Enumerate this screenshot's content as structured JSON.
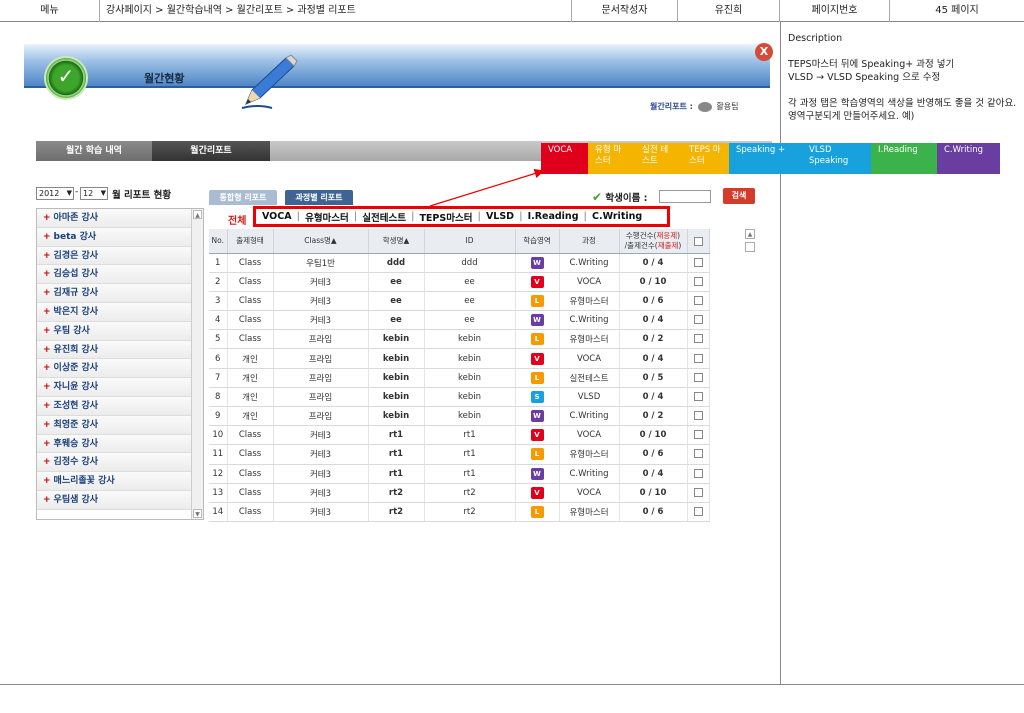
{
  "doc_header": {
    "menu_label": "메뉴",
    "path": "강사페이지 > 월간학습내역 > 월간리포트 > 과정별 리포트",
    "author_label": "문서작성자",
    "author": "유진희",
    "page_label": "페이지번호",
    "page": "45 페이지"
  },
  "description": {
    "title": "Description",
    "line1": "TEPS마스터 뒤에 Speaking+ 과정 넣기",
    "line2": "VLSD → VLSD Speaking 으로 수정",
    "line3": "각 과정 탭은 학습영역의 색상을 반영해도 좋을 것 같아요. 영역구분되게 만들어주세요. 예)"
  },
  "banner": {
    "title": "월간현황",
    "close": "X",
    "tip_label": "월간리포트 :",
    "tip_text": "활용팁"
  },
  "nav_tabs": [
    "월간 학습 내역",
    "월간리포트"
  ],
  "area_tabs": [
    {
      "label": "VOCA",
      "color": "#e0001b"
    },
    {
      "label": "유형 마스터",
      "color": "#f5b400"
    },
    {
      "label": "실전 테스트",
      "color": "#f5b400"
    },
    {
      "label": "TEPS 마스터",
      "color": "#f5b400"
    },
    {
      "label": "Speaking +",
      "color": "#17a2dd"
    },
    {
      "label": "VLSD Speaking",
      "color": "#17a2dd"
    },
    {
      "label": "I.Reading",
      "color": "#3bb34a"
    },
    {
      "label": "C.Writing",
      "color": "#6a3da0"
    }
  ],
  "report_select": {
    "year": "2012",
    "month": "12",
    "title": "월 리포트 현황"
  },
  "teachers": [
    "아마존 강사",
    "beta 강사",
    "김경은 강사",
    "김승섭 강사",
    "김재규 강사",
    "박은지 강사",
    "우팀 강사",
    "유진희 강사",
    "이상준 강사",
    "자니윤 강사",
    "조성현 강사",
    "최영준 강사",
    "후웨승 강사",
    "김정수 강사",
    "매느리졸꽃 강사",
    "우팀샘 강사"
  ],
  "sub_tabs": [
    "통합형 리포트",
    "과정별 리포트"
  ],
  "student_search": {
    "label": "학생이름 :",
    "button": "검색"
  },
  "filter": {
    "all": "전체",
    "items": [
      "VOCA",
      "유형마스터",
      "실전테스트",
      "TEPS마스터",
      "VLSD",
      "I.Reading",
      "C.Writing"
    ]
  },
  "table": {
    "headers": {
      "no": "No.",
      "type": "출제형태",
      "class": "Class명▲",
      "student": "학생명▲",
      "id": "ID",
      "area": "학습영역",
      "course": "과정",
      "count_a": "수행건수(",
      "count_a_red": "재응제",
      "count_a_end": ")",
      "count_b": "/출제건수(",
      "count_b_red": "재출제",
      "count_b_end": ")"
    },
    "rows": [
      {
        "no": "1",
        "type": "Class",
        "class": "우팀1반",
        "student": "ddd",
        "id": "ddd",
        "area": "W",
        "course": "C.Writing",
        "ratio": "0 / 4"
      },
      {
        "no": "2",
        "type": "Class",
        "class": "커테3",
        "student": "ee",
        "id": "ee",
        "area": "V",
        "course": "VOCA",
        "ratio": "0 / 10"
      },
      {
        "no": "3",
        "type": "Class",
        "class": "커테3",
        "student": "ee",
        "id": "ee",
        "area": "L",
        "course": "유형마스터",
        "ratio": "0 / 6"
      },
      {
        "no": "4",
        "type": "Class",
        "class": "커테3",
        "student": "ee",
        "id": "ee",
        "area": "W",
        "course": "C.Writing",
        "ratio": "0 / 4"
      },
      {
        "no": "5",
        "type": "Class",
        "class": "프라임",
        "student": "kebin",
        "id": "kebin",
        "area": "L",
        "course": "유형마스터",
        "ratio": "0 / 2"
      },
      {
        "no": "6",
        "type": "개인",
        "class": "프라임",
        "student": "kebin",
        "id": "kebin",
        "area": "V",
        "course": "VOCA",
        "ratio": "0 / 4"
      },
      {
        "no": "7",
        "type": "개인",
        "class": "프라임",
        "student": "kebin",
        "id": "kebin",
        "area": "L",
        "course": "실전테스트",
        "ratio": "0 / 5"
      },
      {
        "no": "8",
        "type": "개인",
        "class": "프라임",
        "student": "kebin",
        "id": "kebin",
        "area": "S",
        "course": "VLSD",
        "ratio": "0 / 4"
      },
      {
        "no": "9",
        "type": "개인",
        "class": "프라임",
        "student": "kebin",
        "id": "kebin",
        "area": "W",
        "course": "C.Writing",
        "ratio": "0 / 2"
      },
      {
        "no": "10",
        "type": "Class",
        "class": "커테3",
        "student": "rt1",
        "id": "rt1",
        "area": "V",
        "course": "VOCA",
        "ratio": "0 / 10"
      },
      {
        "no": "11",
        "type": "Class",
        "class": "커테3",
        "student": "rt1",
        "id": "rt1",
        "area": "L",
        "course": "유형마스터",
        "ratio": "0 / 6"
      },
      {
        "no": "12",
        "type": "Class",
        "class": "커테3",
        "student": "rt1",
        "id": "rt1",
        "area": "W",
        "course": "C.Writing",
        "ratio": "0 / 4"
      },
      {
        "no": "13",
        "type": "Class",
        "class": "커테3",
        "student": "rt2",
        "id": "rt2",
        "area": "V",
        "course": "VOCA",
        "ratio": "0 / 10"
      },
      {
        "no": "14",
        "type": "Class",
        "class": "커테3",
        "student": "rt2",
        "id": "rt2",
        "area": "L",
        "course": "유형마스터",
        "ratio": "0 / 6"
      }
    ]
  }
}
